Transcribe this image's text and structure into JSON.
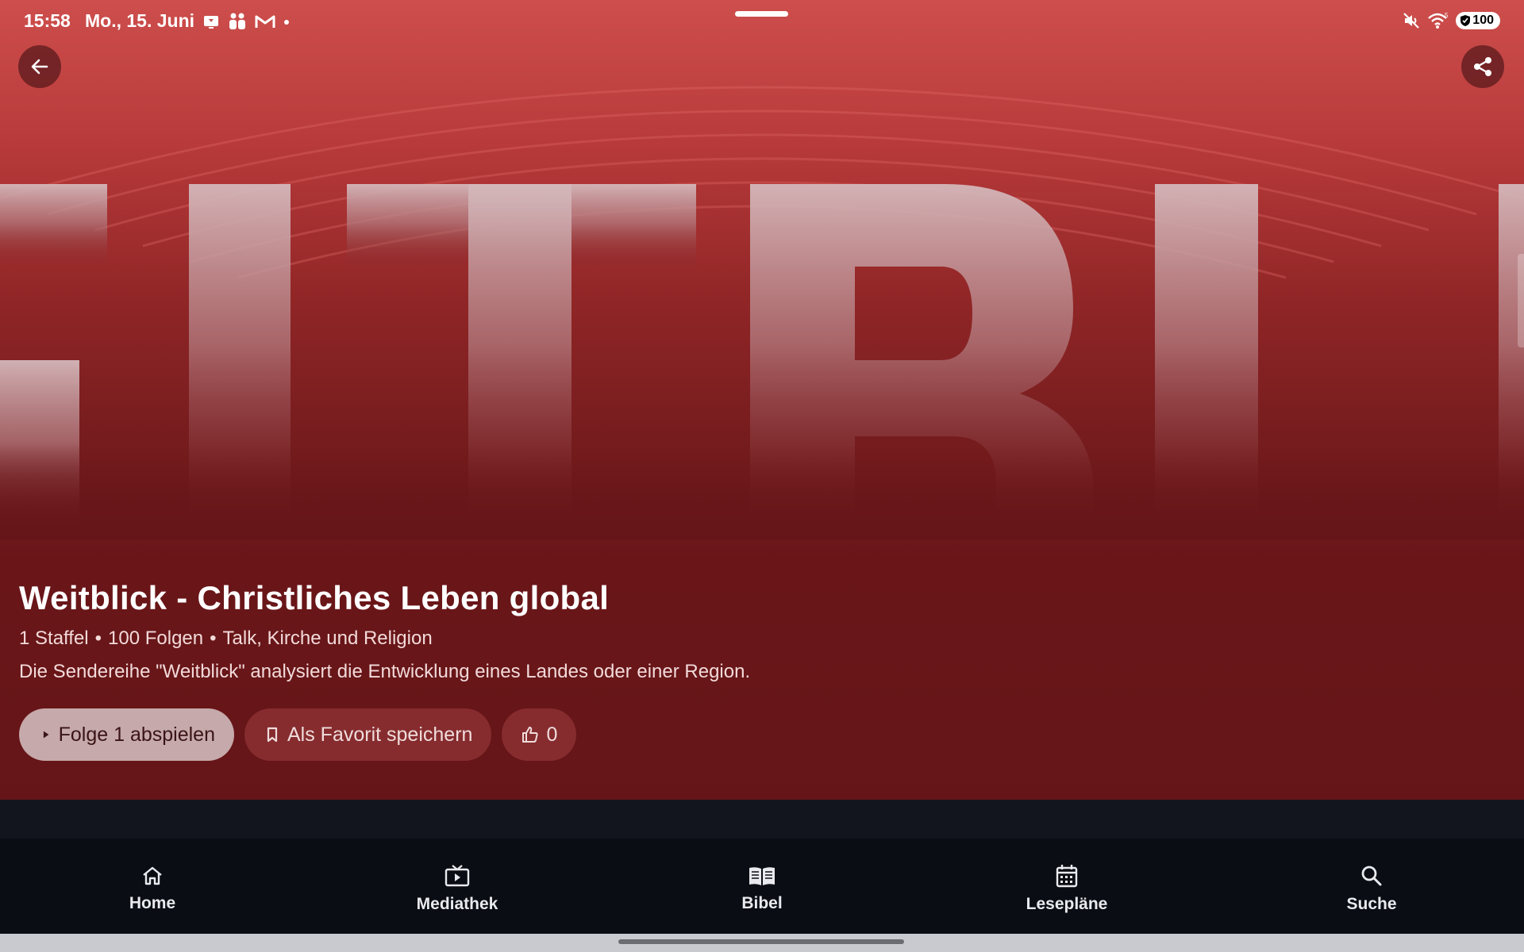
{
  "status_bar": {
    "time": "15:58",
    "date": "Mo., 15. Juni",
    "notification_icons": [
      "cast-icon",
      "teams-icon",
      "gmail-icon",
      "dot-icon"
    ],
    "right_icons": [
      "mute-icon",
      "wifi-icon"
    ],
    "battery": "100"
  },
  "hero": {
    "background_text": "EITBLI",
    "colors": {
      "top": "#cd4e4c",
      "bottom": "#651518"
    }
  },
  "show": {
    "title": "Weitblick - Christliches Leben global",
    "seasons": "1 Staffel",
    "episodes": "100 Folgen",
    "genre": "Talk, Kirche und Religion",
    "separator": "•",
    "description": "Die Sendereihe \"Weitblick\" analysiert die Entwicklung eines Landes oder einer Region."
  },
  "actions": {
    "play_label": "Folge 1 abspielen",
    "favorite_label": "Als Favorit speichern",
    "like_count": "0"
  },
  "nav": {
    "items": [
      {
        "label": "Home",
        "icon": "home-icon"
      },
      {
        "label": "Mediathek",
        "icon": "tv-icon"
      },
      {
        "label": "Bibel",
        "icon": "book-icon"
      },
      {
        "label": "Lesepläne",
        "icon": "calendar-icon"
      },
      {
        "label": "Suche",
        "icon": "search-icon"
      }
    ]
  }
}
